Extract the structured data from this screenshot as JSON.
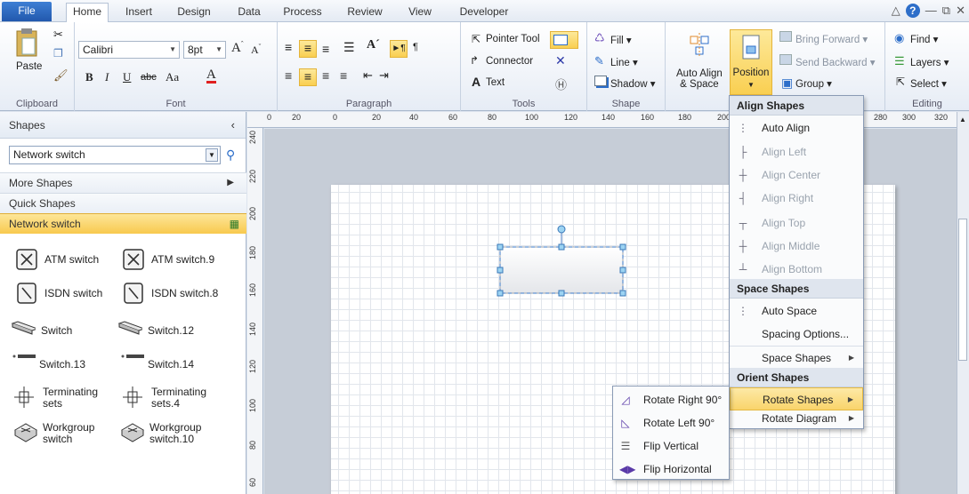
{
  "tabs": [
    "File",
    "Home",
    "Insert",
    "Design",
    "Data",
    "Process",
    "Review",
    "View",
    "Developer"
  ],
  "ribbon": {
    "clipboard": {
      "paste_label": "Paste",
      "group_label": "Clipboard"
    },
    "font": {
      "family": "Calibri",
      "size": "8pt",
      "group_label": "Font",
      "bold": "B",
      "italic": "I",
      "underline": "U",
      "strike": "abc",
      "case": "Aa",
      "color": "A"
    },
    "paragraph": {
      "group_label": "Paragraph"
    },
    "tools": {
      "pointer": "Pointer Tool",
      "connector": "Connector",
      "text": "Text",
      "group_label": "Tools"
    },
    "shape": {
      "fill": "Fill",
      "line": "Line",
      "shadow": "Shadow",
      "group_label": "Shape"
    },
    "arrange": {
      "auto_align": "Auto Align",
      "auto_align_2": "& Space",
      "position": "Position",
      "bring_forward": "Bring Forward",
      "send_backward": "Send Backward",
      "group": "Group"
    },
    "editing": {
      "find": "Find",
      "layers": "Layers",
      "select": "Select",
      "group_label": "Editing"
    }
  },
  "shapes_pane": {
    "title": "Shapes",
    "search_value": "Network switch",
    "more_shapes": "More Shapes",
    "quick_shapes": "Quick Shapes",
    "active_stencil": "Network switch",
    "items": [
      {
        "label": "ATM switch",
        "icon": "atm-switch-icon"
      },
      {
        "label": "ATM switch.9",
        "icon": "atm-switch-icon"
      },
      {
        "label": "ISDN switch",
        "icon": "isdn-switch-icon"
      },
      {
        "label": "ISDN switch.8",
        "icon": "isdn-switch-icon"
      },
      {
        "label": "Switch",
        "icon": "switch-icon"
      },
      {
        "label": "Switch.12",
        "icon": "switch-icon"
      },
      {
        "label": "Switch.13",
        "icon": "switch-flat-icon"
      },
      {
        "label": "Switch.14",
        "icon": "switch-flat-icon"
      },
      {
        "label": "Terminating sets",
        "icon": "terminating-set-icon"
      },
      {
        "label": "Terminating sets.4",
        "icon": "terminating-set-icon"
      },
      {
        "label": "Workgroup switch",
        "icon": "workgroup-switch-icon"
      },
      {
        "label": "Workgroup switch.10",
        "icon": "workgroup-switch-icon"
      }
    ]
  },
  "rulers": {
    "h": [
      "0",
      "20",
      "0",
      "20",
      "40",
      "60",
      "80",
      "100",
      "120",
      "140",
      "160",
      "180",
      "200",
      "280",
      "300",
      "320"
    ],
    "v": [
      "240",
      "220",
      "200",
      "180",
      "160",
      "140",
      "120",
      "100",
      "80",
      "60"
    ]
  },
  "position_menu": {
    "align_header": "Align Shapes",
    "auto_align": "Auto Align",
    "align_left": "Align Left",
    "align_center": "Align Center",
    "align_right": "Align Right",
    "align_top": "Align Top",
    "align_middle": "Align Middle",
    "align_bottom": "Align Bottom",
    "space_header": "Space Shapes",
    "auto_space": "Auto Space",
    "spacing_options": "Spacing Options...",
    "space_shapes": "Space Shapes",
    "orient_header": "Orient Shapes",
    "rotate_shapes": "Rotate Shapes",
    "rotate_diagram": "Rotate Diagram"
  },
  "rotate_menu": {
    "rotate_right": "Rotate Right 90°",
    "rotate_left": "Rotate Left 90°",
    "flip_vertical": "Flip Vertical",
    "flip_horizontal": "Flip Horizontal"
  }
}
